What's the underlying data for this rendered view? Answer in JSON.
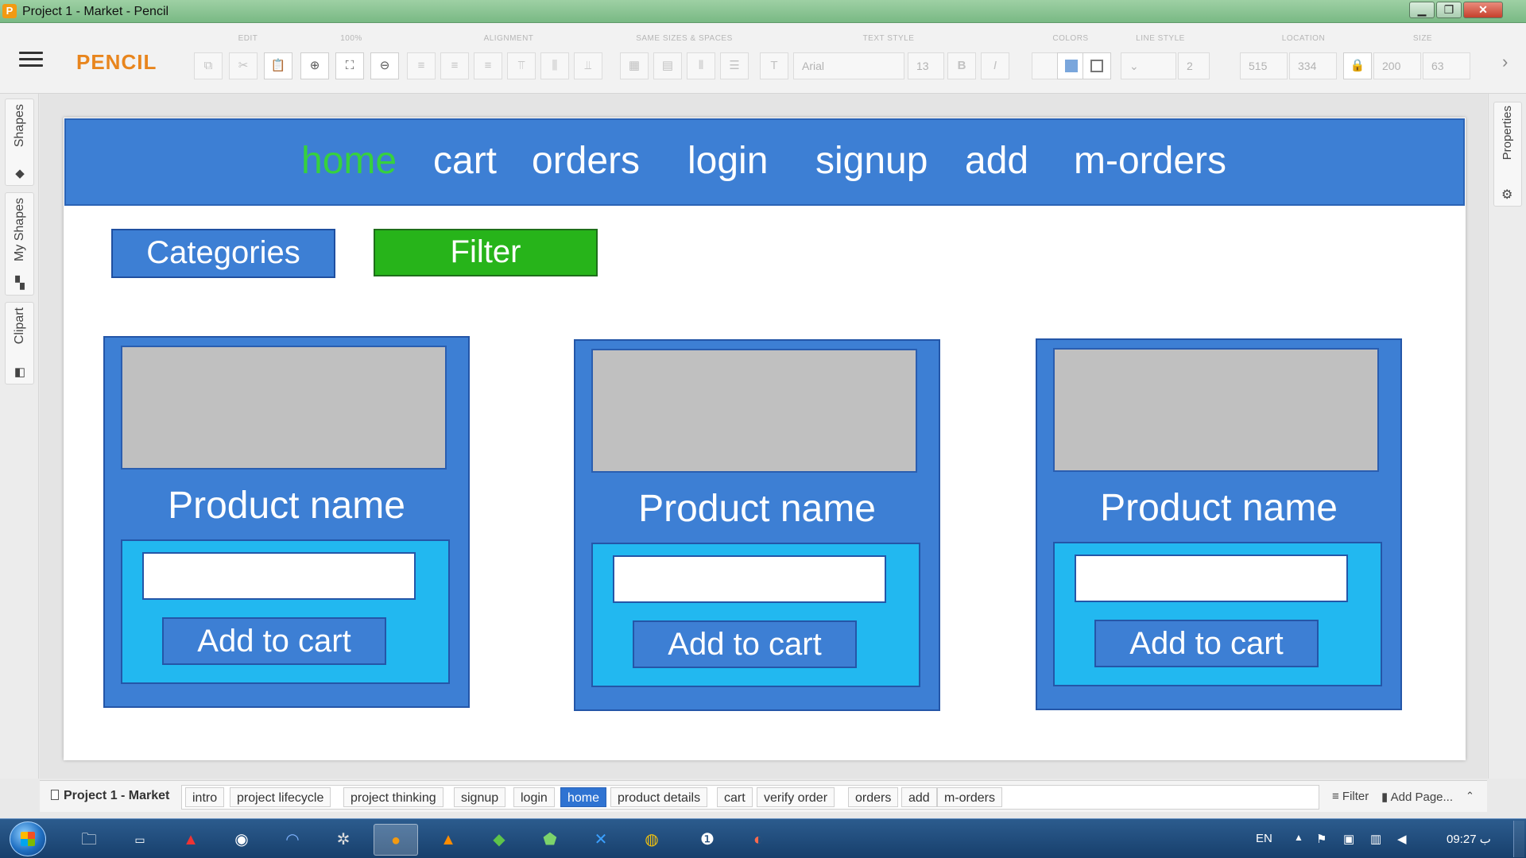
{
  "window": {
    "app_icon": "P",
    "title": "Project 1 - Market - Pencil",
    "min_glyph": "▁",
    "max_glyph": "❐",
    "close_glyph": "✕"
  },
  "toolbar": {
    "brand": "PENCIL",
    "groups": {
      "edit": "EDIT",
      "zoom": "100%",
      "alignment": "ALIGNMENT",
      "same_sizes": "SAME SIZES & SPACES",
      "text_style": "TEXT STYLE",
      "colors": "COLORS",
      "line_style": "LINE STYLE",
      "location": "LOCATION",
      "size": "SIZE"
    },
    "font_family": "Arial",
    "font_size": "13",
    "bold": "B",
    "italic": "I",
    "line_width": "2",
    "location_x": "515",
    "location_y": "334",
    "size_w": "200",
    "size_h": "63",
    "more": "›"
  },
  "sidebar": {
    "shapes": "Shapes",
    "my_shapes": "My Shapes",
    "clipart": "Clipart",
    "properties": "Properties"
  },
  "canvas": {
    "nav": [
      "home",
      "cart",
      "orders",
      "login",
      "signup",
      "add",
      "m-orders"
    ],
    "current_nav": "home",
    "categories_button": "Categories",
    "filter_button": "Filter",
    "products": [
      {
        "name": "Product name",
        "button": "Add to cart"
      },
      {
        "name": "Product name",
        "button": "Add to cart"
      },
      {
        "name": "Product name",
        "button": "Add to cart"
      }
    ]
  },
  "pages": {
    "document": "Project 1 - Market",
    "tabs": [
      "intro",
      "project lifecycle",
      "project thinking",
      "signup",
      "login",
      "home",
      "product details",
      "cart",
      "verify order",
      "orders",
      "add",
      "m-orders"
    ],
    "active_tab": "home",
    "filter": "Filter",
    "add_page": "Add Page...",
    "collapse": "⌃"
  },
  "taskbar": {
    "language": "EN",
    "clock": "09:27 ب",
    "accent": "#1f4f85"
  },
  "colors": {
    "nav_bg": "#3d7fd4",
    "nav_active": "#36d13e",
    "filter_green": "#27b41a",
    "panel_cyan": "#22b8f0",
    "placeholder_gray": "#c0c0c0",
    "brand_orange": "#e8851d"
  }
}
